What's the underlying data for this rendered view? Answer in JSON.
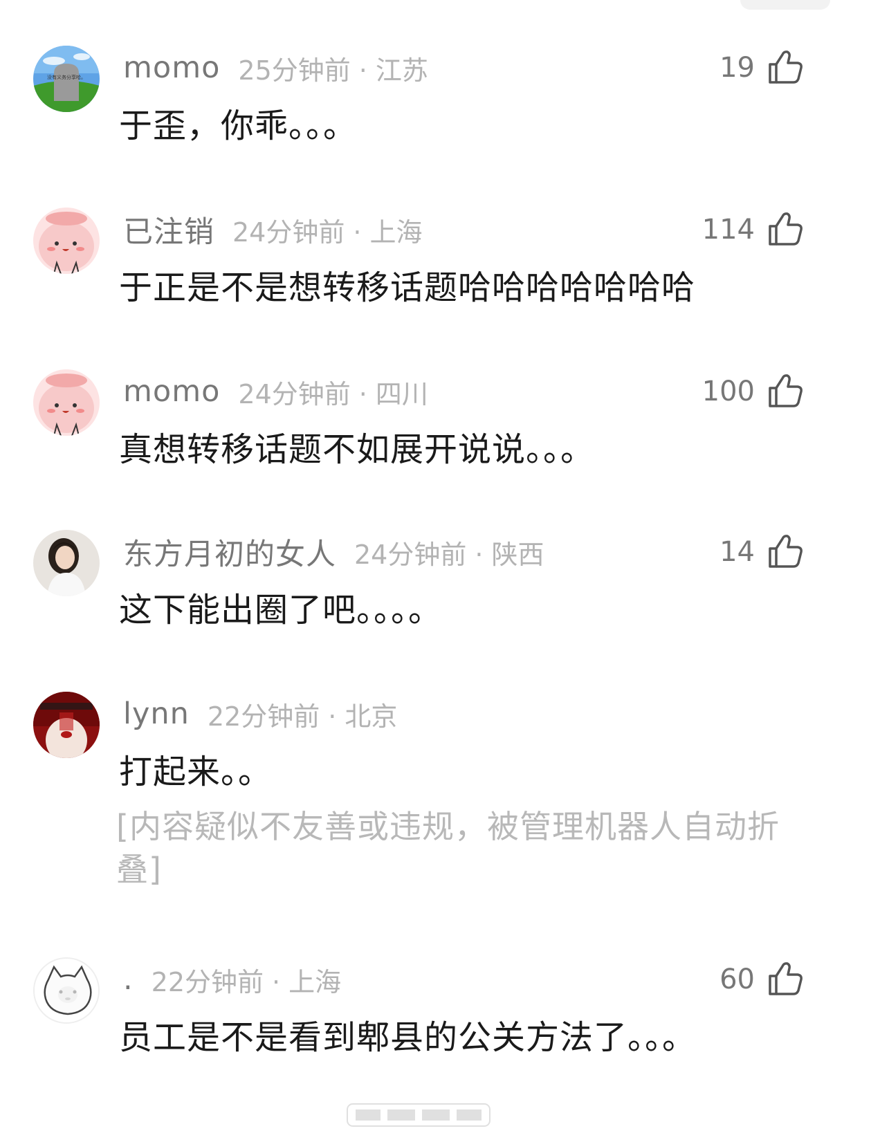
{
  "comments": [
    {
      "username": "momo",
      "time": "25分钟前",
      "location": "江苏",
      "likes": "19",
      "text": "于歪，你乖。。。",
      "avatar": "tombstone-meadow-avatar",
      "avatar_text": "没有义务分享哈。"
    },
    {
      "username": "已注销",
      "time": "24分钟前",
      "location": "上海",
      "likes": "114",
      "text": "于正是不是想转移话题哈哈哈哈哈哈哈",
      "avatar": "pink-cartoon-avatar"
    },
    {
      "username": "momo",
      "time": "24分钟前",
      "location": "四川",
      "likes": "100",
      "text": "真想转移话题不如展开说说。。。",
      "avatar": "pink-cartoon-avatar"
    },
    {
      "username": "东方月初的女人",
      "time": "24分钟前",
      "location": "陕西",
      "likes": "14",
      "text": "这下能出圈了吧。。。。",
      "avatar": "portrait-avatar"
    },
    {
      "username": "lynn",
      "time": "22分钟前",
      "location": "北京",
      "likes": "",
      "text": "打起来。。",
      "folded_notice": "[内容疑似不友善或违规，被管理机器人自动折叠]",
      "avatar": "red-face-avatar"
    },
    {
      "username": ".",
      "time": "22分钟前",
      "location": "上海",
      "likes": "60",
      "text": "员工是不是看到郫县的公关方法了。。。",
      "avatar": "white-cat-avatar"
    }
  ],
  "separator": "·",
  "icons": {
    "like": "thumbs-up-icon"
  },
  "colors": {
    "username": "#777777",
    "meta": "#b3b3b3",
    "body_text": "#1a1a1a",
    "folded_text": "#b8b8b8"
  }
}
